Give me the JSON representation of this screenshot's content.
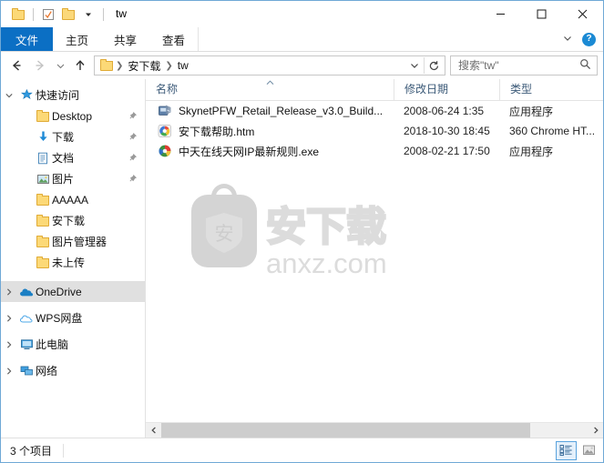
{
  "window": {
    "title": "tw",
    "quick_access_toolbar": [
      {
        "name": "folder-icon",
        "label": "属性"
      },
      {
        "name": "properties-icon",
        "label": "属性"
      },
      {
        "name": "new-folder-icon",
        "label": "新建文件夹"
      },
      {
        "name": "chevron-down-icon",
        "label": "自定义快速访问工具栏"
      }
    ],
    "controls": {
      "minimize": "最小化",
      "maximize": "最大化",
      "close": "关闭"
    }
  },
  "ribbon": {
    "tabs": [
      {
        "label": "文件",
        "active": true
      },
      {
        "label": "主页",
        "active": false
      },
      {
        "label": "共享",
        "active": false
      },
      {
        "label": "查看",
        "active": false
      }
    ],
    "expand_label": "展开功能区",
    "help_label": "?"
  },
  "navbar": {
    "back": "后退",
    "forward": "前进",
    "recent": "最近浏览的位置",
    "up": "上移一级",
    "breadcrumb": [
      "安下载",
      "tw"
    ],
    "refresh": "刷新",
    "history_chevron": "历史记录"
  },
  "search": {
    "placeholder": "搜索\"tw\"",
    "value": "",
    "icon": "search-icon"
  },
  "sidebar": {
    "items": [
      {
        "label": "快速访问",
        "icon": "star-pin-icon",
        "chevron": "expanded",
        "indent": 0,
        "pinned": false,
        "hover": false
      },
      {
        "label": "Desktop",
        "icon": "folder-icon",
        "chevron": "none",
        "indent": 1,
        "pinned": true,
        "hover": false
      },
      {
        "label": "下载",
        "icon": "download-icon",
        "chevron": "none",
        "indent": 1,
        "pinned": true,
        "hover": false
      },
      {
        "label": "文档",
        "icon": "document-icon",
        "chevron": "none",
        "indent": 1,
        "pinned": true,
        "hover": false
      },
      {
        "label": "图片",
        "icon": "picture-icon",
        "chevron": "none",
        "indent": 1,
        "pinned": true,
        "hover": false
      },
      {
        "label": "AAAAA",
        "icon": "folder-icon",
        "chevron": "none",
        "indent": 1,
        "pinned": false,
        "hover": false
      },
      {
        "label": "安下载",
        "icon": "folder-icon",
        "chevron": "none",
        "indent": 1,
        "pinned": false,
        "hover": false
      },
      {
        "label": "图片管理器",
        "icon": "folder-icon",
        "chevron": "none",
        "indent": 1,
        "pinned": false,
        "hover": false
      },
      {
        "label": "未上传",
        "icon": "folder-icon",
        "chevron": "none",
        "indent": 1,
        "pinned": false,
        "hover": false
      },
      {
        "label": "OneDrive",
        "icon": "onedrive-icon",
        "chevron": "collapsed",
        "indent": 0,
        "pinned": false,
        "hover": true
      },
      {
        "label": "WPS网盘",
        "icon": "wps-cloud-icon",
        "chevron": "collapsed",
        "indent": 0,
        "pinned": false,
        "hover": false
      },
      {
        "label": "此电脑",
        "icon": "this-pc-icon",
        "chevron": "collapsed",
        "indent": 0,
        "pinned": false,
        "hover": false
      },
      {
        "label": "网络",
        "icon": "network-icon",
        "chevron": "collapsed",
        "indent": 0,
        "pinned": false,
        "hover": false
      }
    ]
  },
  "filelist": {
    "columns": [
      {
        "label": "名称",
        "sorted": "asc"
      },
      {
        "label": "修改日期",
        "sorted": "none"
      },
      {
        "label": "类型",
        "sorted": "none"
      }
    ],
    "rows": [
      {
        "name": "SkynetPFW_Retail_Release_v3.0_Build...",
        "date": "2008-06-24 1:35",
        "type": "应用程序",
        "icon": "application-icon"
      },
      {
        "name": "安下载帮助.htm",
        "date": "2018-10-30 18:45",
        "type": "360 Chrome HT...",
        "icon": "chrome360-html-icon"
      },
      {
        "name": "中天在线天网IP最新规则.exe",
        "date": "2008-02-21 17:50",
        "type": "应用程序",
        "icon": "application-icon"
      }
    ]
  },
  "watermark": {
    "glyph": "安",
    "brand": "安下载",
    "domain": "anxz.com"
  },
  "statusbar": {
    "item_count": "3 个项目",
    "views": [
      {
        "name": "details-view",
        "label": "详细信息",
        "active": true
      },
      {
        "name": "large-icons-view",
        "label": "大图标",
        "active": false
      }
    ]
  },
  "colors": {
    "accent": "#0b6fc4",
    "folder": "#fcd977",
    "header_text": "#3c5a78",
    "hover": "#e0e0e0"
  }
}
